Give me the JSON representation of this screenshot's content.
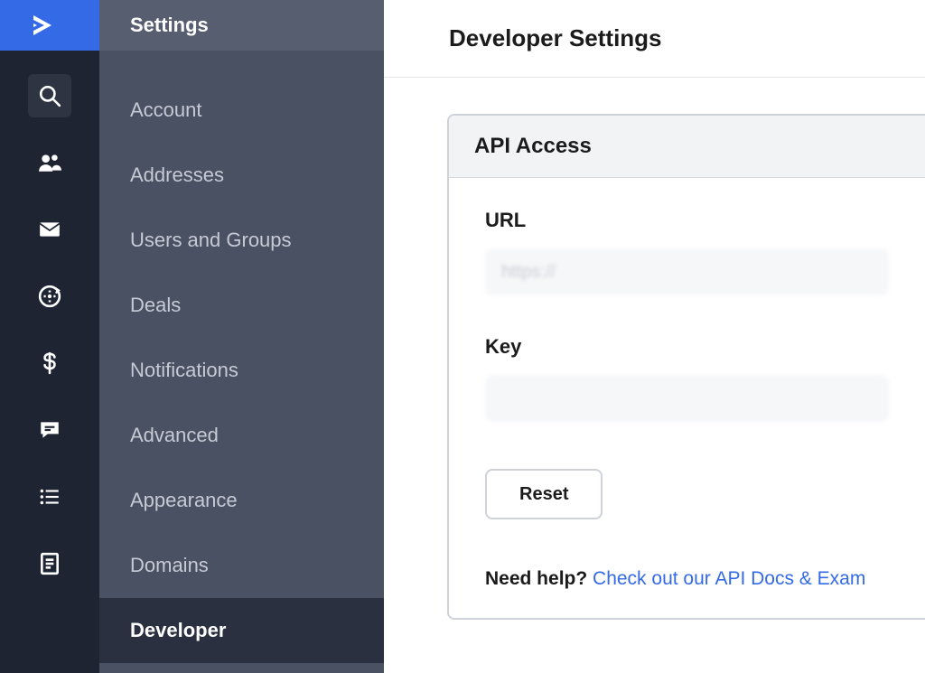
{
  "colors": {
    "accent": "#356ae6"
  },
  "icon_rail": {
    "logo": "brand-chevron",
    "items": [
      {
        "name": "search-icon"
      },
      {
        "name": "contacts-icon"
      },
      {
        "name": "mail-icon"
      },
      {
        "name": "automation-gear-icon"
      },
      {
        "name": "dollar-icon"
      },
      {
        "name": "chat-icon"
      },
      {
        "name": "list-icon"
      },
      {
        "name": "document-icon"
      }
    ]
  },
  "sidebar": {
    "title": "Settings",
    "items": [
      {
        "label": "Account"
      },
      {
        "label": "Addresses"
      },
      {
        "label": "Users and Groups"
      },
      {
        "label": "Deals"
      },
      {
        "label": "Notifications"
      },
      {
        "label": "Advanced"
      },
      {
        "label": "Appearance"
      },
      {
        "label": "Domains"
      },
      {
        "label": "Developer",
        "active": true
      }
    ]
  },
  "main": {
    "title": "Developer Settings",
    "panel_title": "API Access",
    "url_label": "URL",
    "url_value_preview": "https://",
    "key_label": "Key",
    "key_value_preview": "",
    "reset_label": "Reset",
    "help_prefix": "Need help?",
    "help_link_text": "Check out our API Docs & Exam"
  }
}
